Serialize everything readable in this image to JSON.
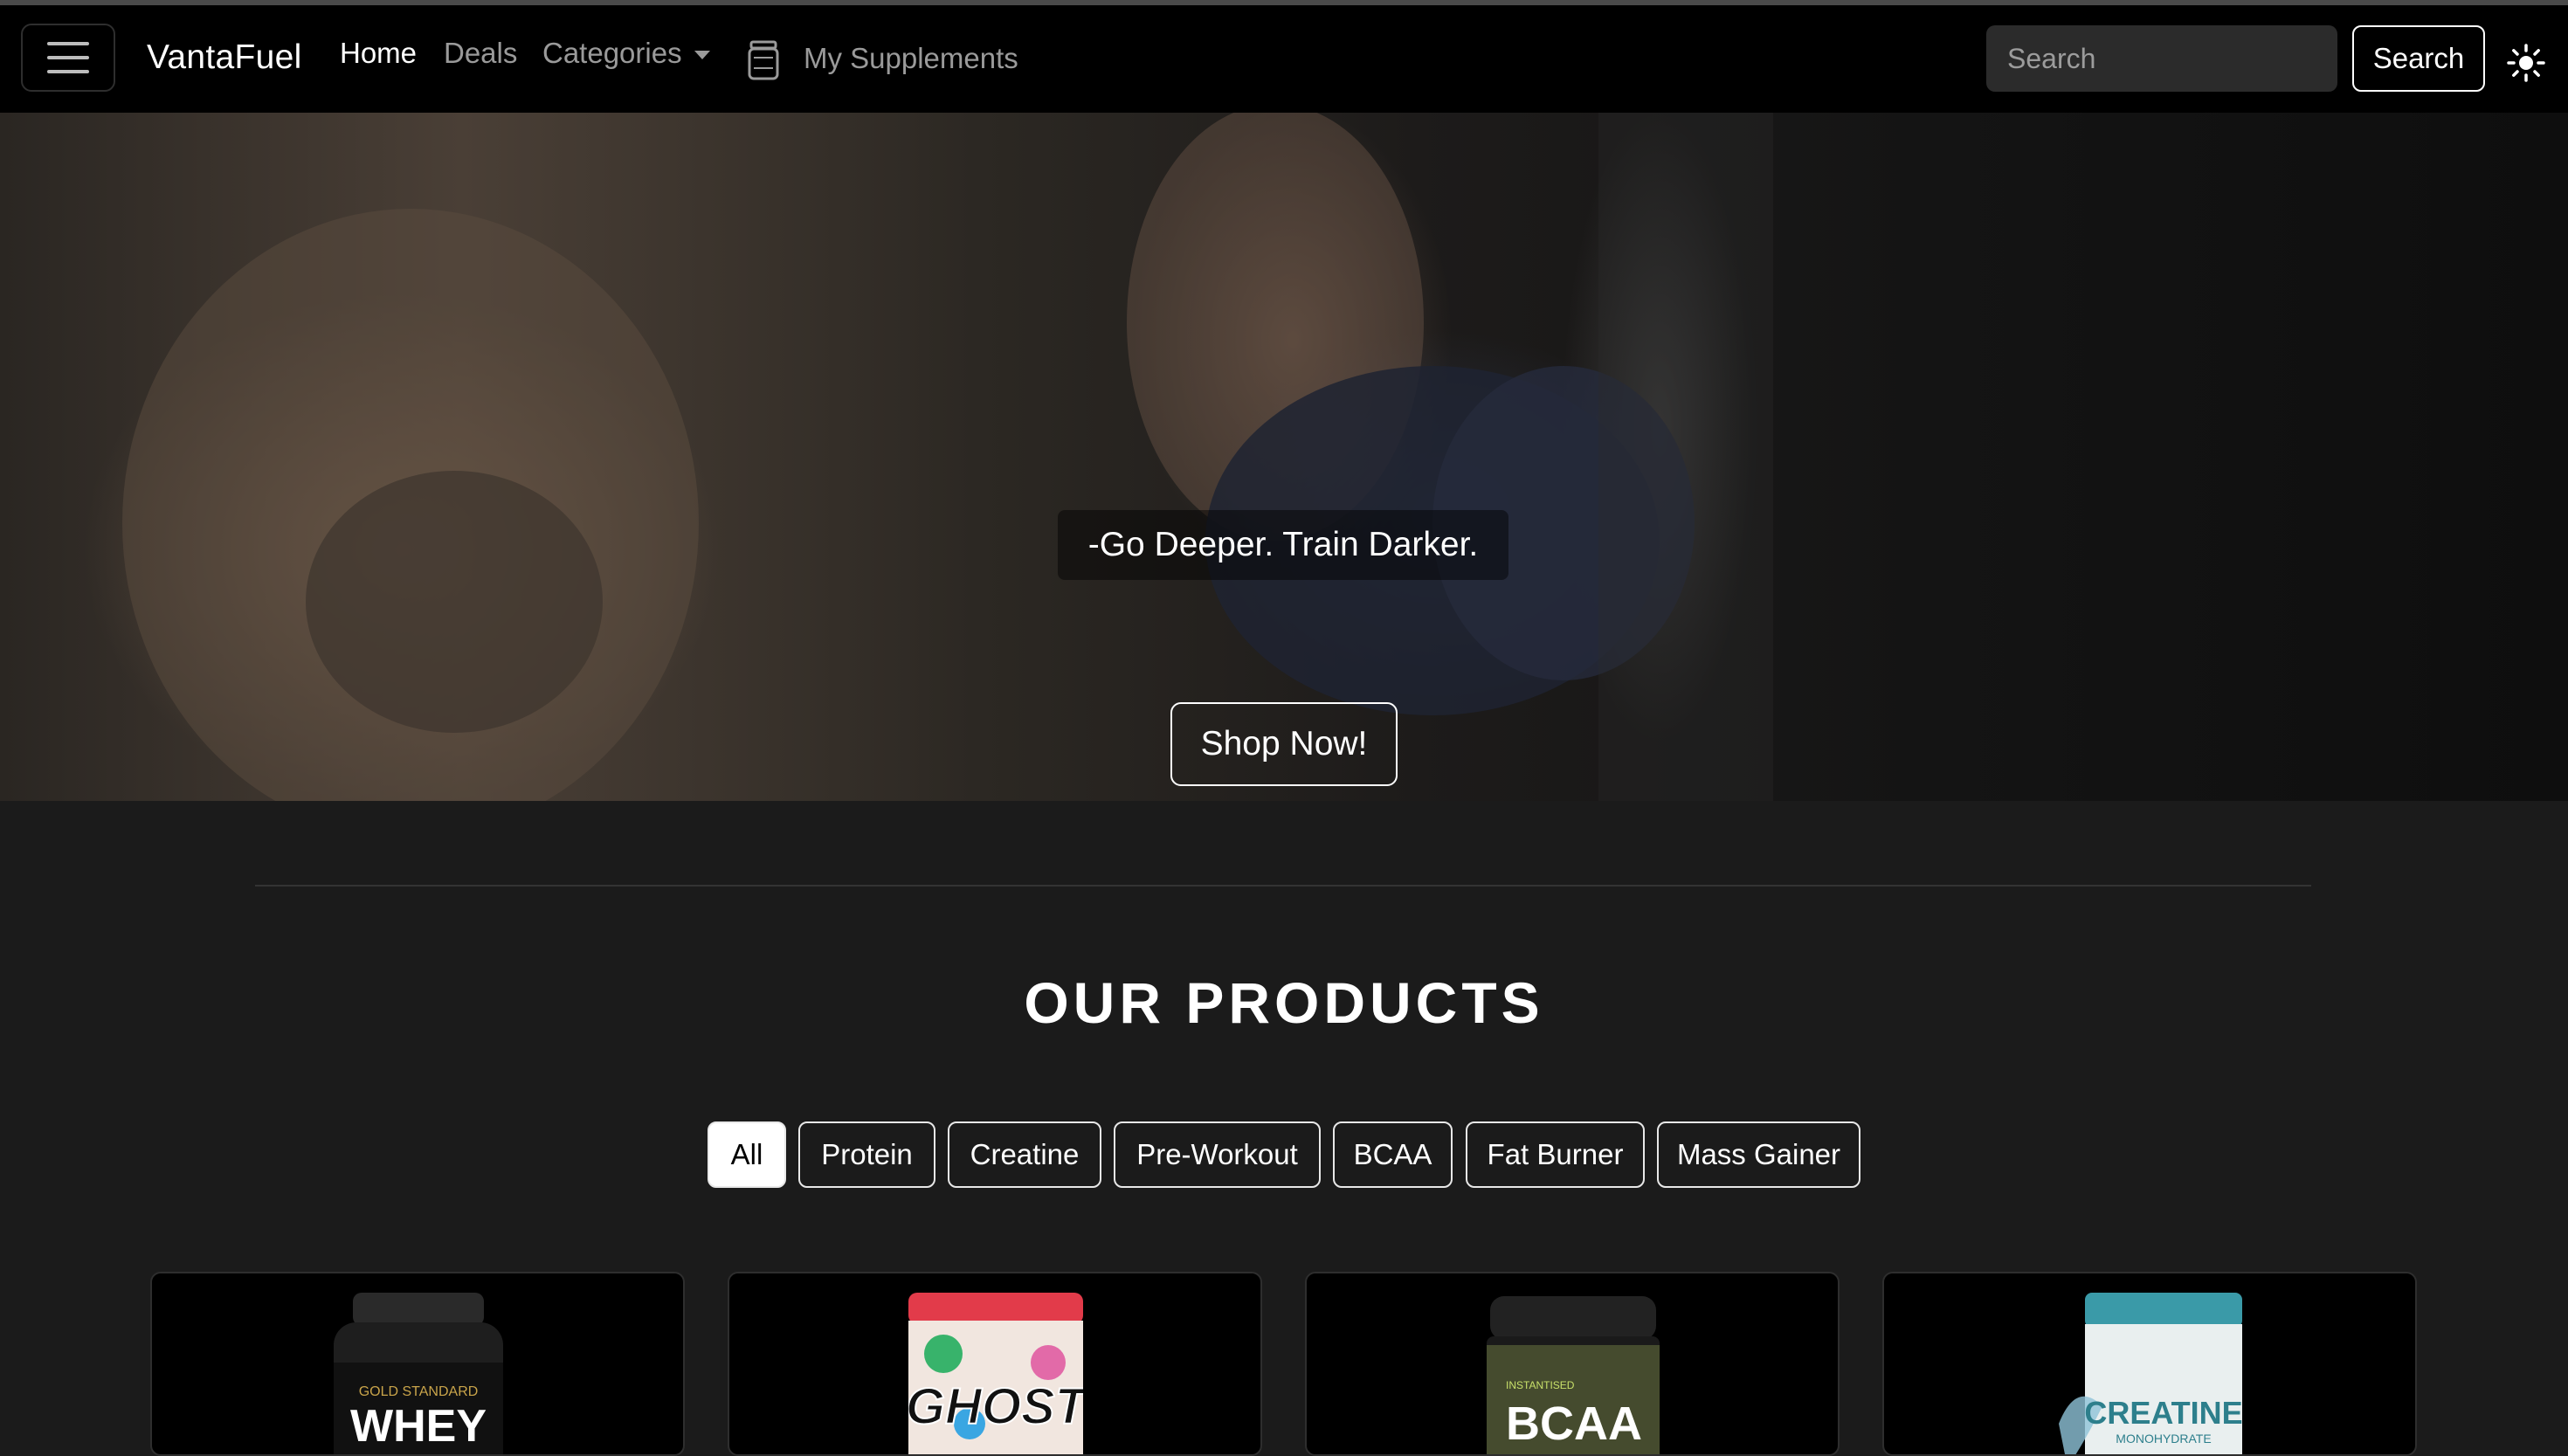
{
  "navbar": {
    "brand": "VantaFuel",
    "links": [
      {
        "label": "Home",
        "active": true
      },
      {
        "label": "Deals",
        "active": false
      },
      {
        "label": "Categories",
        "active": false
      }
    ],
    "my_supplements_label": "My Supplements",
    "search": {
      "placeholder": "Search",
      "button_label": "Search"
    },
    "icons": [
      "menu-icon",
      "supplement-jar-icon",
      "sun-icon"
    ]
  },
  "hero": {
    "caption": "-Go Deeper. Train Darker.",
    "cta_label": "Shop Now!"
  },
  "products_section": {
    "title": "OUR PRODUCTS",
    "filters": [
      {
        "label": "All",
        "active": true
      },
      {
        "label": "Protein",
        "active": false
      },
      {
        "label": "Creatine",
        "active": false
      },
      {
        "label": "Pre-Workout",
        "active": false
      },
      {
        "label": "BCAA",
        "active": false
      },
      {
        "label": "Fat Burner",
        "active": false
      },
      {
        "label": "Mass Gainer",
        "active": false
      }
    ],
    "cards": [
      {
        "label_top": "GOLD STANDARD",
        "label_main": "WHEY",
        "accent": "#c9a44a"
      },
      {
        "label_main": "GHOST",
        "accent": "#e23b4a"
      },
      {
        "label_top": "INSTANTISED",
        "label_main": "BCAA",
        "accent": "#c8e06a"
      },
      {
        "label_main": "CREATINE",
        "label_sub": "MONOHYDRATE",
        "accent": "#3a9aa8"
      }
    ]
  },
  "colors": {
    "background": "#1b1b1b",
    "navbar": "#000000",
    "muted_text": "#9a9a9a"
  }
}
